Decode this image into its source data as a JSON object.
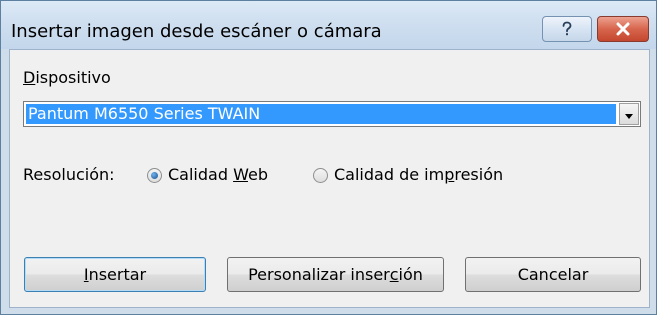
{
  "window": {
    "title": "Insertar imagen desde escáner o cámara"
  },
  "titlebar": {
    "help_glyph": "?",
    "help_icon": "help-icon",
    "close_icon": "close-icon"
  },
  "device": {
    "label_accel": "D",
    "label_rest": "ispositivo",
    "selected": "Pantum M6550 Series TWAIN"
  },
  "resolution": {
    "label": "Resolución:",
    "options": [
      {
        "pre": "Calidad ",
        "accel": "W",
        "post": "eb",
        "checked": true
      },
      {
        "pre": "Calidad de im",
        "accel": "p",
        "post": "resión",
        "checked": false
      }
    ]
  },
  "buttons": {
    "insert": {
      "accel": "I",
      "rest": "nsertar"
    },
    "custom_insert": {
      "pre": "Personalizar inser",
      "accel": "c",
      "post": "ión"
    },
    "cancel": "Cancelar"
  },
  "colors": {
    "selection": "#3399ff",
    "titlebar": "#cfdff0",
    "close_button": "#c4472e",
    "dialog_face": "#f0f0f0"
  }
}
